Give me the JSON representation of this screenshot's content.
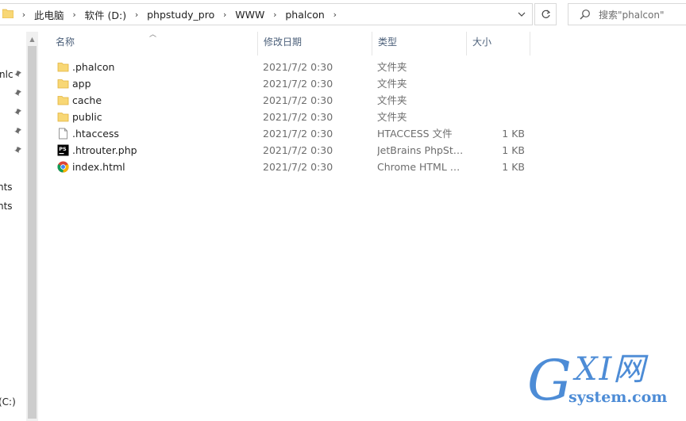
{
  "address_bar": {
    "breadcrumbs": [
      "此电脑",
      "软件 (D:)",
      "phpstudy_pro",
      "WWW",
      "phalcon"
    ]
  },
  "search": {
    "placeholder": "搜索\"phalcon\""
  },
  "nav_pane": {
    "items": [
      {
        "label": "nlc",
        "pinned": true
      },
      {
        "label": "",
        "pinned": true
      },
      {
        "label": "",
        "pinned": true
      },
      {
        "label": "",
        "pinned": true
      },
      {
        "label": "",
        "pinned": true
      },
      {
        "label": "nts",
        "pinned": false
      },
      {
        "label": "nts",
        "pinned": false
      },
      {
        "label": "(C:)",
        "pinned": false
      }
    ]
  },
  "columns": {
    "name": "名称",
    "date": "修改日期",
    "type": "类型",
    "size": "大小"
  },
  "files": [
    {
      "name": ".phalcon",
      "date": "2021/7/2 0:30",
      "type": "文件夹",
      "size": "",
      "icon": "folder-icon"
    },
    {
      "name": "app",
      "date": "2021/7/2 0:30",
      "type": "文件夹",
      "size": "",
      "icon": "folder-icon"
    },
    {
      "name": "cache",
      "date": "2021/7/2 0:30",
      "type": "文件夹",
      "size": "",
      "icon": "folder-icon"
    },
    {
      "name": "public",
      "date": "2021/7/2 0:30",
      "type": "文件夹",
      "size": "",
      "icon": "folder-icon"
    },
    {
      "name": ".htaccess",
      "date": "2021/7/2 0:30",
      "type": "HTACCESS 文件",
      "size": "1 KB",
      "icon": "file-icon"
    },
    {
      "name": ".htrouter.php",
      "date": "2021/7/2 0:30",
      "type": "JetBrains PhpSto...",
      "size": "1 KB",
      "icon": "phpstorm-icon"
    },
    {
      "name": "index.html",
      "date": "2021/7/2 0:30",
      "type": "Chrome HTML D...",
      "size": "1 KB",
      "icon": "chrome-icon"
    }
  ],
  "watermark": {
    "main": "XI网",
    "letter": "G",
    "sub": "system.com"
  },
  "colors": {
    "folder": "#f8d775",
    "header_text": "#4c607a",
    "watermark": "#4d8cd6"
  }
}
